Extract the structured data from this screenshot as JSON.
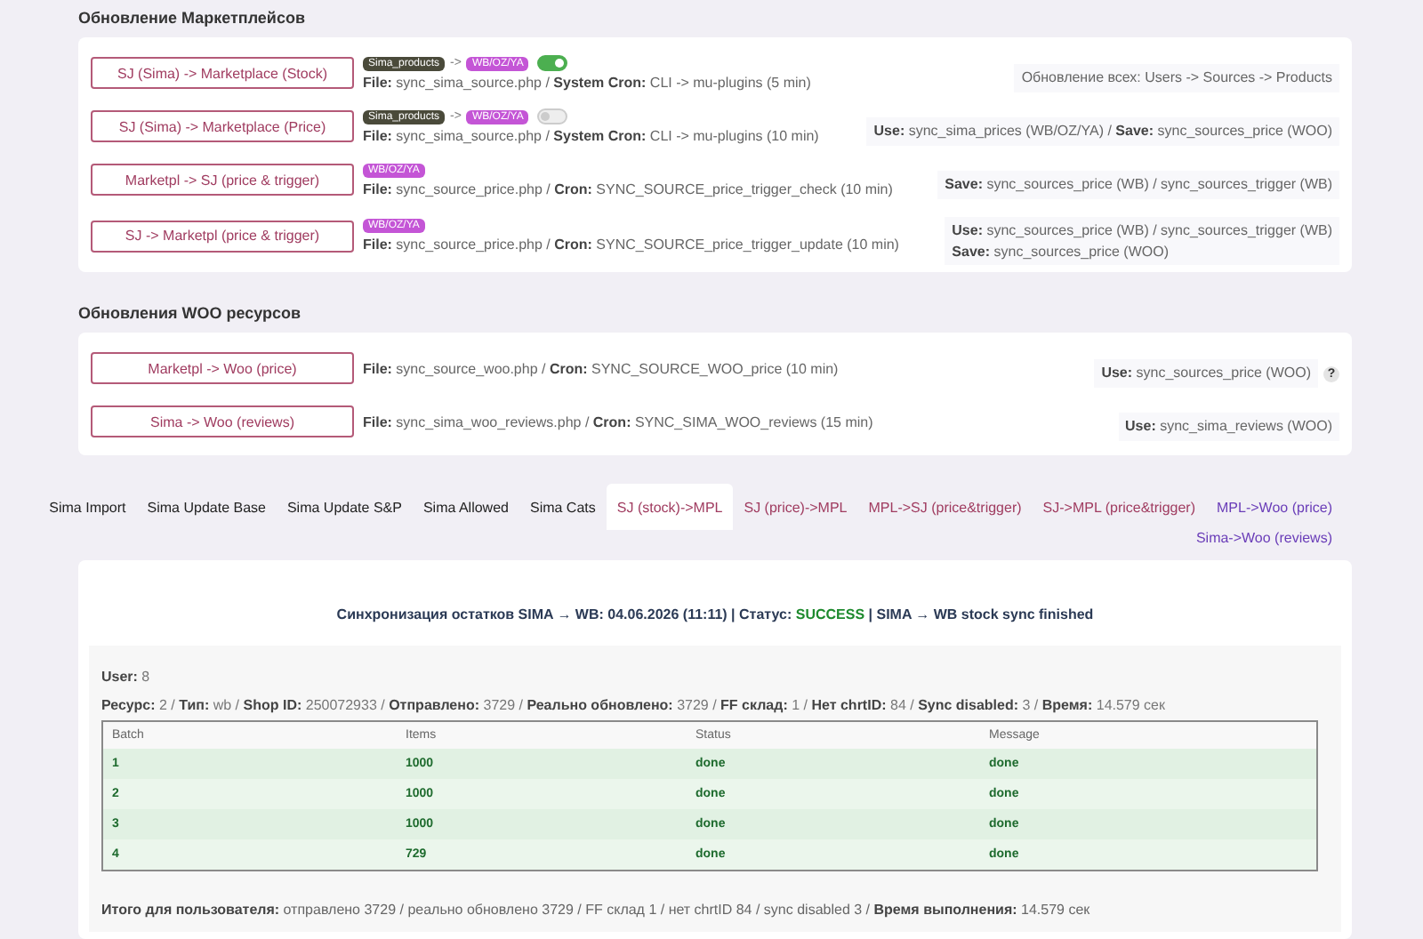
{
  "sections": [
    {
      "title": "Обновление Маркетплейсов",
      "rows": [
        {
          "button": "SJ (Sima) -> Marketplace (Stock)",
          "tags": [
            {
              "label": "Sima_products",
              "kind": "source"
            },
            {
              "label": "->",
              "kind": "arrow"
            },
            {
              "label": "WB/OZ/YA",
              "kind": "target"
            }
          ],
          "toggle": {
            "on": true
          },
          "file": "**File:** sync_sima_source.php / **System Cron:** CLI -> mu-plugins (5 min)",
          "info": [
            "Обновление всех: Users -> Sources -> Products"
          ]
        },
        {
          "button": "SJ (Sima) -> Marketplace (Price)",
          "tags": [
            {
              "label": "Sima_products",
              "kind": "source"
            },
            {
              "label": "->",
              "kind": "arrow"
            },
            {
              "label": "WB/OZ/YA",
              "kind": "target"
            }
          ],
          "toggle": {
            "on": false
          },
          "file": "**File:** sync_sima_source.php / **System Cron:** CLI -> mu-plugins (10 min)",
          "info": [
            "**Use:** sync_sima_prices (WB/OZ/YA) / **Save:** sync_sources_price (WOO)"
          ]
        },
        {
          "button": "Marketpl -> SJ (price & trigger)",
          "tags": [
            {
              "label": "WB/OZ/YA",
              "kind": "target"
            }
          ],
          "file": "**File:** sync_source_price.php / **Cron:** SYNC_SOURCE_price_trigger_check (10 min)",
          "info": [
            "**Save:** sync_sources_price (WB) / sync_sources_trigger (WB)"
          ]
        },
        {
          "button": "SJ -> Marketpl (price & trigger)",
          "tags": [
            {
              "label": "WB/OZ/YA",
              "kind": "target"
            }
          ],
          "file": "**File:** sync_source_price.php / **Cron:** SYNC_SOURCE_price_trigger_update (10 min)",
          "info": [
            "**Use:** sync_sources_price (WB) / sync_sources_trigger (WB)",
            "**Save:** sync_sources_price (WOO)"
          ]
        }
      ]
    },
    {
      "title": "Обновления WOO ресурсов",
      "rows": [
        {
          "button": "Marketpl -> Woo (price)",
          "file": "**File:** sync_source_woo.php / **Cron:** SYNC_SOURCE_WOO_price (10 min)",
          "info": [
            "**Use:** sync_sources_price (WOO)"
          ],
          "help": "?"
        },
        {
          "button": "Sima -> Woo (reviews)",
          "file": "**File:** sync_sima_woo_reviews.php / **Cron:** SYNC_SIMA_WOO_reviews (15 min)",
          "info": [
            "**Use:** sync_sima_reviews (WOO)"
          ]
        }
      ]
    }
  ],
  "tabs": [
    {
      "label": "Sima Import",
      "kind": "plain",
      "selected": false
    },
    {
      "label": "Sima Update Base",
      "kind": "plain",
      "selected": false
    },
    {
      "label": "Sima Update S&P",
      "kind": "plain",
      "selected": false
    },
    {
      "label": "Sima Allowed",
      "kind": "plain",
      "selected": false
    },
    {
      "label": "Sima Cats",
      "kind": "plain",
      "selected": false
    },
    {
      "label": "SJ (stock)->MPL",
      "kind": "marketplace",
      "selected": true
    },
    {
      "label": "SJ (price)->MPL",
      "kind": "marketplace",
      "selected": false
    },
    {
      "label": "MPL->SJ (price&trigger)",
      "kind": "marketplace",
      "selected": false
    },
    {
      "label": "SJ->MPL (price&trigger)",
      "kind": "marketplace",
      "selected": false
    },
    {
      "label": "MPL->Woo (price)",
      "kind": "woo",
      "selected": false
    },
    {
      "label": "Sima->Woo (reviews)",
      "kind": "woo",
      "selected": false
    }
  ],
  "report": {
    "title": "Синхронизация остатков SIMA → WB: 04.06.2026 (11:11) | Статус:",
    "status": "SUCCESS",
    "status_ok": true,
    "title_end": "| SIMA → WB stock sync finished",
    "stats": [
      "**User:** 8",
      "**Ресурс:** 2 / **Тип:** wb / **Shop ID:** 250072933 / **Отправлено:** 3729 / **Реально обновлено:** 3729 / **FF склад:** 1 / **Нет chrtID:** 84 / **Sync disabled:** 3 / **Время:** 14.579 сек"
    ],
    "columns": [
      "Batch",
      "Items",
      "Status",
      "Message"
    ],
    "rows": [
      {
        "cells": [
          "1",
          "1000",
          "done",
          "done"
        ],
        "ok": true
      },
      {
        "cells": [
          "2",
          "1000",
          "done",
          "done"
        ],
        "ok": true
      },
      {
        "cells": [
          "3",
          "1000",
          "done",
          "done"
        ],
        "ok": true
      },
      {
        "cells": [
          "4",
          "729",
          "done",
          "done"
        ],
        "ok": true
      }
    ],
    "footer": "**Итого для пользователя:** отправлено 3729 / реально обновлено 3729 / FF склад 1 / нет chrtID 84 / sync disabled 3 / **Время выполнения:** 14.579 сек"
  }
}
